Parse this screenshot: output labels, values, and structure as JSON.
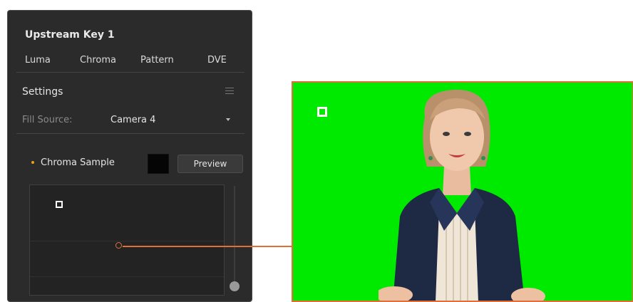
{
  "panel": {
    "title": "Upstream Key 1",
    "tabs": [
      "Luma",
      "Chroma",
      "Pattern",
      "DVE"
    ],
    "settings": {
      "title": "Settings",
      "menu_icon": "hamburger-icon",
      "fill_source_label": "Fill Source:",
      "fill_source_value": "Camera 4"
    },
    "chroma_sample": {
      "label": "Chroma Sample",
      "status_color": "#e8a020",
      "swatch_color": "#050505",
      "preview_label": "Preview"
    }
  },
  "colors": {
    "panel_bg": "#2b2b2b",
    "accent_orange": "#e0703a",
    "chroma_green": "#00ea00"
  }
}
